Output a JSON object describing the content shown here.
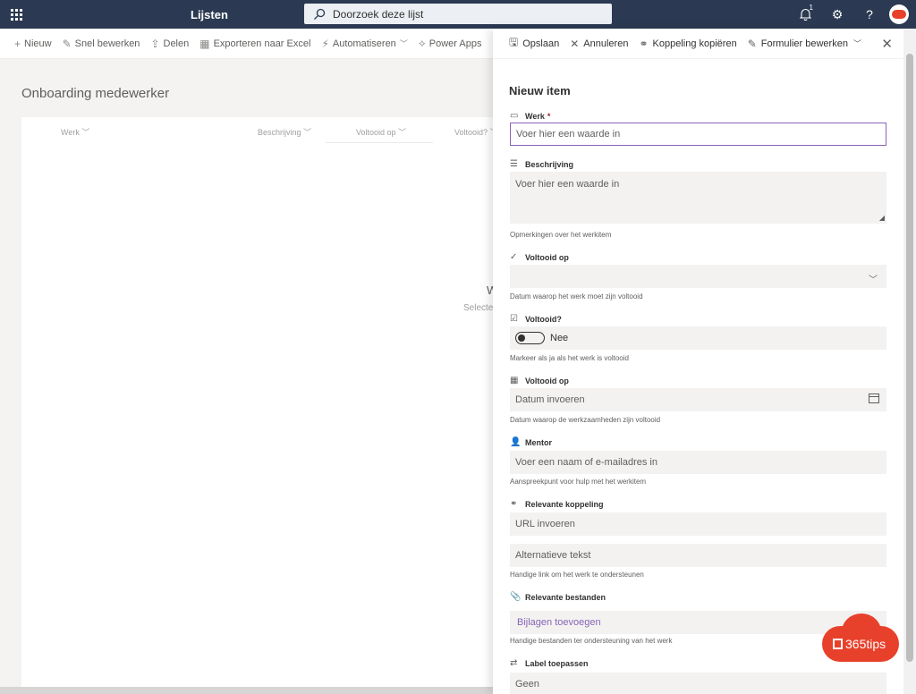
{
  "suitebar": {
    "app_title": "Lijsten",
    "search_placeholder": "Doorzoek deze lijst",
    "notification_count": "1"
  },
  "commandbar": {
    "items": [
      {
        "icon": "plus-icon",
        "label": "Nieuw"
      },
      {
        "icon": "pencil-icon",
        "label": "Snel bewerken"
      },
      {
        "icon": "share-icon",
        "label": "Delen"
      },
      {
        "icon": "excel-icon",
        "label": "Exporteren naar Excel"
      },
      {
        "icon": "automate-icon",
        "label": "Automatiseren"
      },
      {
        "icon": "powerapps-icon",
        "label": "Power Apps"
      }
    ]
  },
  "list": {
    "title": "Onboarding medewerker",
    "columns": [
      "Werk",
      "Beschrijving",
      "Voltooid op",
      "Voltooid?"
    ],
    "empty_heading": "W",
    "empty_subtext": "Selecte"
  },
  "panel": {
    "commands": {
      "save": "Opslaan",
      "cancel": "Annuleren",
      "copy_link": "Koppeling kopiëren",
      "edit_form": "Formulier bewerken"
    },
    "title": "Nieuw item",
    "fields": {
      "werk": {
        "label": "Werk",
        "required": "*",
        "placeholder": "Voer hier een waarde in"
      },
      "beschrijving": {
        "label": "Beschrijving",
        "placeholder": "Voer hier een waarde in",
        "help": "Opmerkingen over het werkitem"
      },
      "voltooid_op_1": {
        "label": "Voltooid op",
        "help": "Datum waarop het werk moet zijn voltooid"
      },
      "voltooid": {
        "label": "Voltooid?",
        "value": "Nee",
        "help": "Markeer als ja als het werk is voltooid"
      },
      "voltooid_op_2": {
        "label": "Voltooid op",
        "placeholder": "Datum invoeren",
        "help": "Datum waarop de werkzaamheden zijn voltooid"
      },
      "mentor": {
        "label": "Mentor",
        "placeholder": "Voer een naam of e-mailadres in",
        "help": "Aanspreekpunt voor hulp met het werkitem"
      },
      "koppeling": {
        "label": "Relevante koppeling",
        "url_placeholder": "URL invoeren",
        "alt_placeholder": "Alternatieve tekst",
        "help": "Handige link om het werk te ondersteunen"
      },
      "bestanden": {
        "label": "Relevante bestanden",
        "action": "Bijlagen toevoegen",
        "help": "Handige bestanden ter ondersteuning van het werk"
      },
      "label": {
        "label": "Label toepassen",
        "value": "Geen"
      }
    }
  },
  "watermark": {
    "text": "365tips"
  },
  "colors": {
    "suitebar": "#2b3a52",
    "accent": "#8764b8",
    "brand_red": "#e8412b"
  }
}
